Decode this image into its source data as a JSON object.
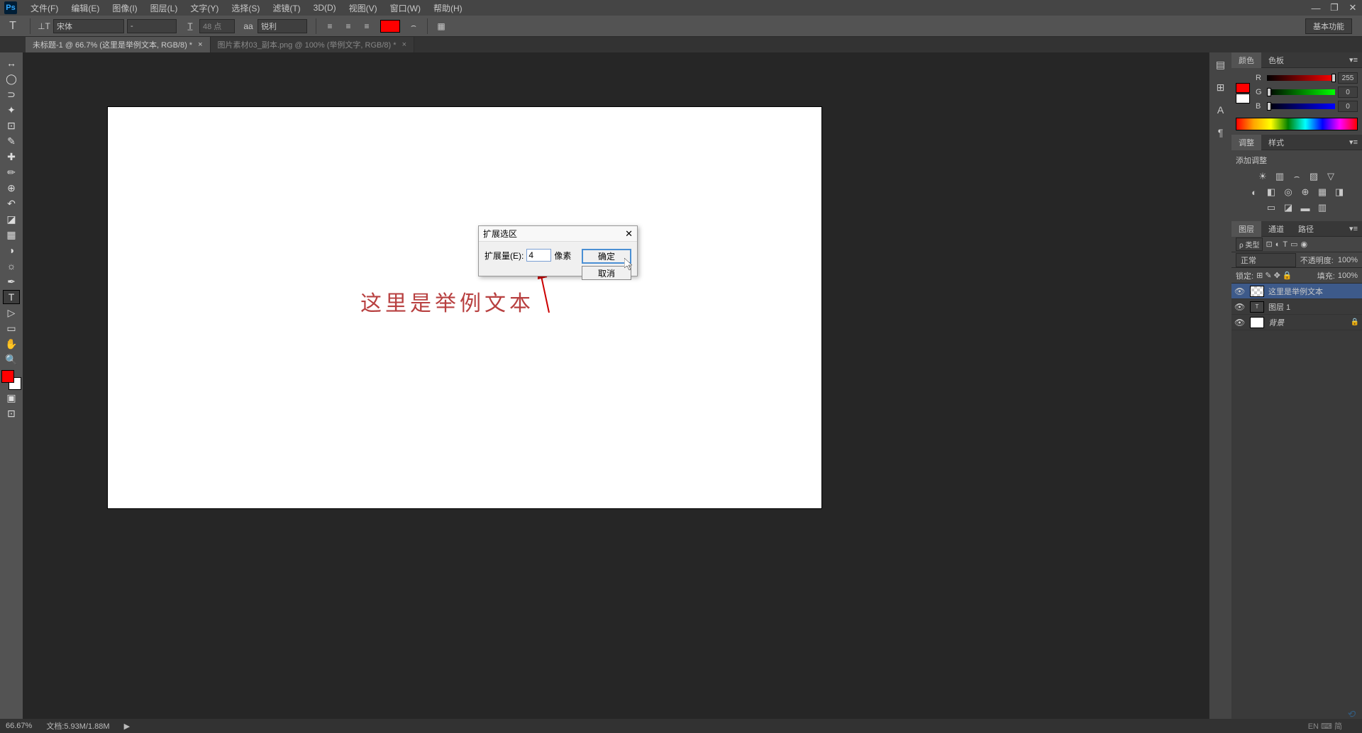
{
  "app": {
    "logo": "Ps"
  },
  "menu": {
    "file": "文件(F)",
    "edit": "编辑(E)",
    "image": "图像(I)",
    "layer": "图层(L)",
    "type": "文字(Y)",
    "select": "选择(S)",
    "filter": "滤镜(T)",
    "threed": "3D(D)",
    "view": "视图(V)",
    "window": "窗口(W)",
    "help": "帮助(H)"
  },
  "options": {
    "font_family": "宋体",
    "font_style": "-",
    "font_size": "48 点",
    "aa_label": "aa",
    "aa_mode": "锐利",
    "color": "#ff0000",
    "basic_func": "基本功能"
  },
  "tabs": {
    "tab1": "未标题-1 @ 66.7% (这里是举例文本, RGB/8) *",
    "tab2": "图片素材03_副本.png @ 100% (举例文字, RGB/8) *"
  },
  "canvas": {
    "sample_text": "这里是举例文本"
  },
  "dialog": {
    "title": "扩展选区",
    "expand_label": "扩展量(E):",
    "value": "4",
    "unit": "像素",
    "ok": "确定",
    "cancel": "取消"
  },
  "panels": {
    "color": {
      "tab1": "颜色",
      "tab2": "色板",
      "r_label": "R",
      "g_label": "G",
      "b_label": "B",
      "r_val": "255",
      "g_val": "0",
      "b_val": "0"
    },
    "adjust": {
      "tab1": "调整",
      "tab2": "样式",
      "label": "添加调整"
    },
    "layers": {
      "tab1": "图层",
      "tab2": "通道",
      "tab3": "路径",
      "filter_label": "ρ 类型",
      "blend_mode": "正常",
      "opacity_label": "不透明度:",
      "opacity_val": "100%",
      "lock_label": "锁定:",
      "fill_label": "填充:",
      "fill_val": "100%",
      "layer1": "这里是举例文本",
      "layer2": "图层 1",
      "layer3": "背景"
    }
  },
  "status": {
    "zoom": "66.67%",
    "doc_info": "文档:5.93M/1.88M",
    "ime": "EN ⌨ 简"
  }
}
